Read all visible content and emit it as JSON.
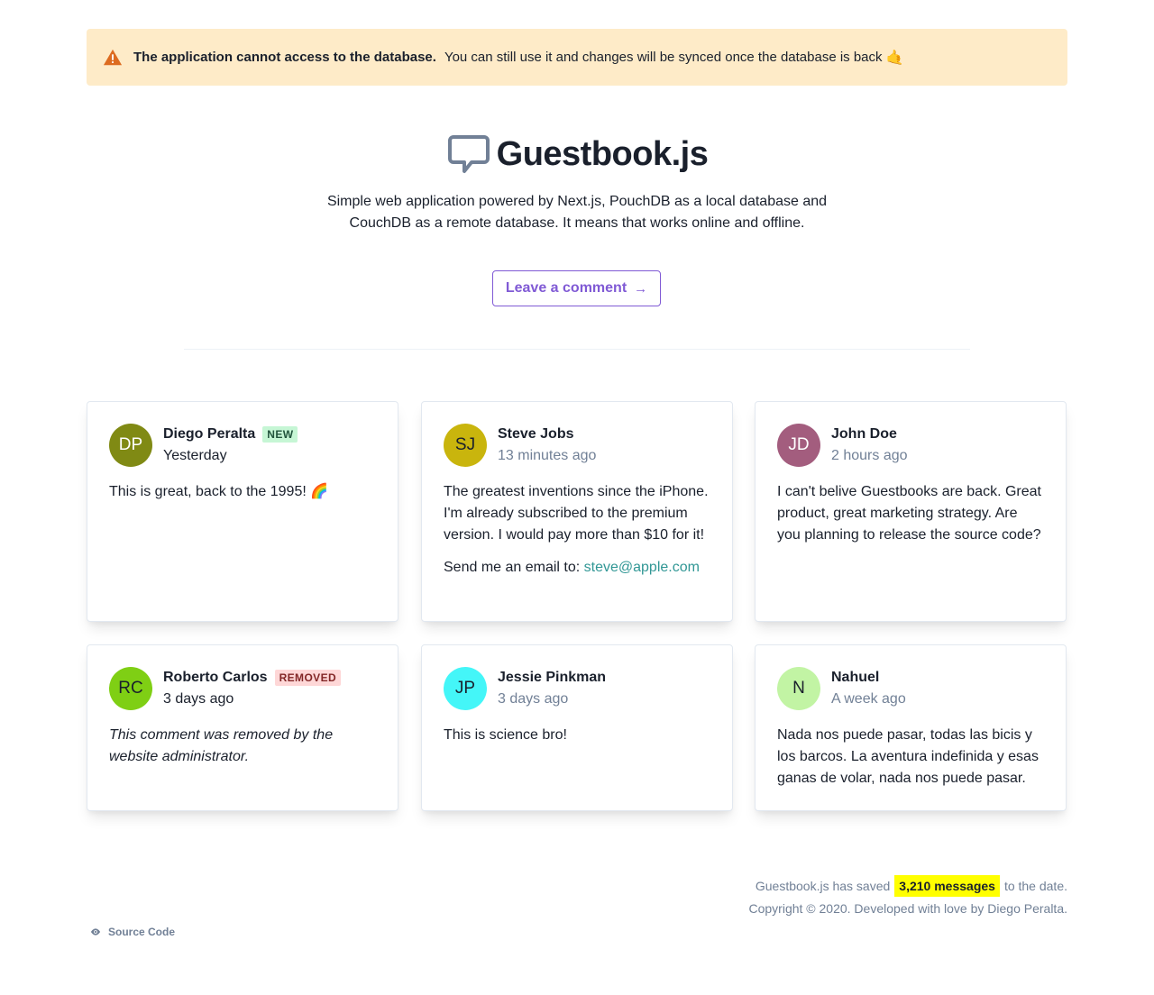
{
  "alert": {
    "title": "The application cannot access to the database.",
    "message": "You can still use it and changes will be synced once the database is back",
    "emoji": "🤙",
    "icon": "warning-icon"
  },
  "hero": {
    "title": "Guestbook.js",
    "icon": "chat-bubble-icon",
    "description": "Simple web application powered by Next.js, PouchDB as a local database and CouchDB as a remote database. It means that works online and offline.",
    "cta": "Leave a comment",
    "cta_icon": "arrow-right-icon"
  },
  "comments": [
    {
      "initials": "DP",
      "name": "Diego Peralta",
      "badge": "NEW",
      "time": "Yesterday",
      "text": "This is great, back to the 1995! 🌈",
      "avatar_bg": "#808a14",
      "avatar_fg": "#ffffff"
    },
    {
      "initials": "SJ",
      "name": "Steve Jobs",
      "badge": "",
      "time": "13 minutes ago",
      "text": "The greatest inventions since the iPhone. I'm already subscribed to the premium version. I would pay more than $10 for it!",
      "text2_prefix": "Send me an email to: ",
      "text2_link": "steve@apple.com",
      "avatar_bg": "#c9b50d",
      "avatar_fg": "#1a202c"
    },
    {
      "initials": "JD",
      "name": "John Doe",
      "badge": "",
      "time": "2 hours ago",
      "text": "I can't belive Guestbooks are back. Great product, great marketing strategy. Are you planning to release the source code?",
      "avatar_bg": "#a35d7e",
      "avatar_fg": "#ffffff"
    },
    {
      "initials": "RC",
      "name": "Roberto Carlos",
      "badge": "REMOVED",
      "time": "3 days ago",
      "text": "This comment was removed by the website administrator.",
      "avatar_bg": "#7fcf14",
      "avatar_fg": "#1a202c"
    },
    {
      "initials": "JP",
      "name": "Jessie Pinkman",
      "badge": "",
      "time": "3 days ago",
      "text": "This is science bro!",
      "avatar_bg": "#44f6f8",
      "avatar_fg": "#1a202c"
    },
    {
      "initials": "N",
      "name": "Nahuel",
      "badge": "",
      "time": "A week ago",
      "text": "Nada nos puede pasar, todas las bicis y los barcos. La aventura indefinida y esas ganas de volar, nada nos puede pasar.",
      "avatar_bg": "#c2f4a4",
      "avatar_fg": "#1a202c"
    }
  ],
  "footer": {
    "stats_prefix": "Guestbook.js has saved",
    "stats_highlight": "3,210 messages",
    "stats_suffix": "to the date.",
    "copyright": "Copyright © 2020. Developed with love by Diego Peralta.",
    "source_label": "Source Code",
    "source_icon": "eye-icon"
  },
  "colors": {
    "accent": "#805ad5",
    "alert_bg": "#feebc8",
    "link": "#319795",
    "highlight": "#ffff00"
  }
}
